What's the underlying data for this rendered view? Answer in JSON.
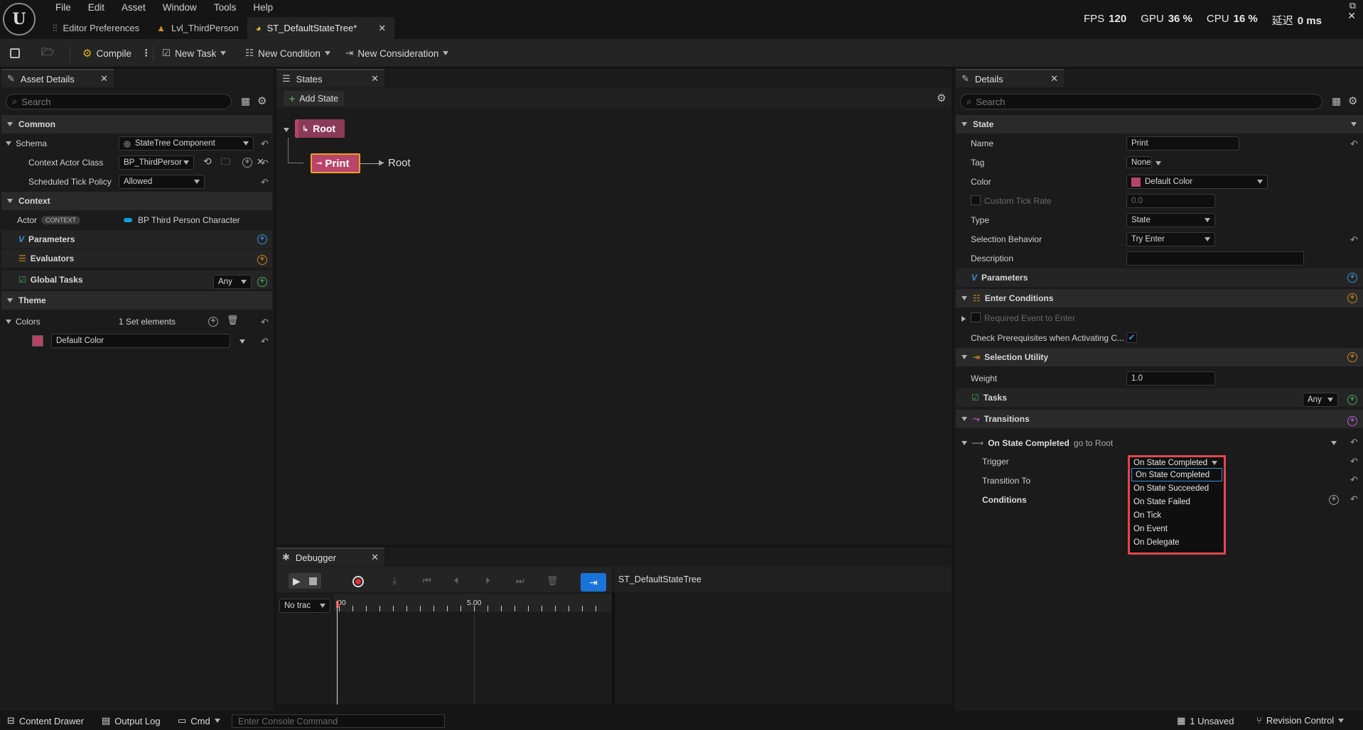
{
  "menu": {
    "items": [
      "File",
      "Edit",
      "Asset",
      "Window",
      "Tools",
      "Help"
    ]
  },
  "tabs": [
    {
      "label": "Editor Preferences"
    },
    {
      "label": "Lvl_ThirdPerson"
    },
    {
      "label": "ST_DefaultStateTree*"
    }
  ],
  "stats": {
    "fps_label": "FPS",
    "fps": "120",
    "gpu_label": "GPU",
    "gpu": "36 %",
    "cpu_label": "CPU",
    "cpu": "16 %",
    "latency_label": "延迟",
    "latency": "0 ms"
  },
  "toolbar": {
    "compile": "Compile",
    "new_task": "New Task",
    "new_condition": "New Condition",
    "new_consideration": "New Consideration"
  },
  "asset_details": {
    "tab": "Asset Details",
    "search_placeholder": "Search",
    "common": "Common",
    "schema_label": "Schema",
    "schema_value": "StateTree Component",
    "context_actor_class_label": "Context Actor Class",
    "context_actor_class_value": "BP_ThirdPersor",
    "scheduled_tick_label": "Scheduled Tick Policy",
    "scheduled_tick_value": "Allowed",
    "context": "Context",
    "actor_label": "Actor",
    "actor_badge": "CONTEXT",
    "actor_value": "BP Third Person Character",
    "parameters": "Parameters",
    "evaluators": "Evaluators",
    "global_tasks": "Global Tasks",
    "global_tasks_any": "Any",
    "theme": "Theme",
    "colors_label": "Colors",
    "colors_value": "1 Set elements",
    "default_color": "Default Color"
  },
  "states": {
    "tab": "States",
    "add_state": "Add State",
    "root": "Root",
    "print": "Print",
    "print_target": "Root"
  },
  "debugger": {
    "tab": "Debugger",
    "asset": "ST_DefaultStateTree",
    "track_select": "No trac",
    "tick_0": "00",
    "tick_5": "5.00"
  },
  "details": {
    "tab": "Details",
    "search_placeholder": "Search",
    "state_section": "State",
    "name_label": "Name",
    "name_value": "Print",
    "tag_label": "Tag",
    "tag_value": "None",
    "color_label": "Color",
    "color_value": "Default Color",
    "custom_tick_label": "Custom Tick Rate",
    "custom_tick_value": "0.0",
    "type_label": "Type",
    "type_value": "State",
    "selection_behavior_label": "Selection Behavior",
    "selection_behavior_value": "Try Enter",
    "description_label": "Description",
    "parameters": "Parameters",
    "enter_conditions": "Enter Conditions",
    "required_event_label": "Required Event to Enter",
    "check_prereq_label": "Check Prerequisites when Activating C...",
    "selection_utility": "Selection Utility",
    "weight_label": "Weight",
    "weight_value": "1.0",
    "tasks": "Tasks",
    "tasks_any": "Any",
    "transitions": "Transitions",
    "transition_header_bold": "On State Completed",
    "transition_header_rest": "go to Root",
    "trigger_label": "Trigger",
    "trigger_value": "On State Completed",
    "transition_to_label": "Transition To",
    "conditions_label": "Conditions"
  },
  "trigger_dropdown": {
    "options": [
      "On State Completed",
      "On State Succeeded",
      "On State Failed",
      "On Tick",
      "On Event",
      "On Delegate"
    ]
  },
  "bottombar": {
    "content_drawer": "Content Drawer",
    "output_log": "Output Log",
    "cmd": "Cmd",
    "console_placeholder": "Enter Console Command",
    "unsaved": "1 Unsaved",
    "revision_control": "Revision Control"
  },
  "colors": {
    "accent_blue": "#1a73d9",
    "state_pink": "#b8446a",
    "highlight_red": "#e2474c",
    "swatch": "#b64466"
  }
}
